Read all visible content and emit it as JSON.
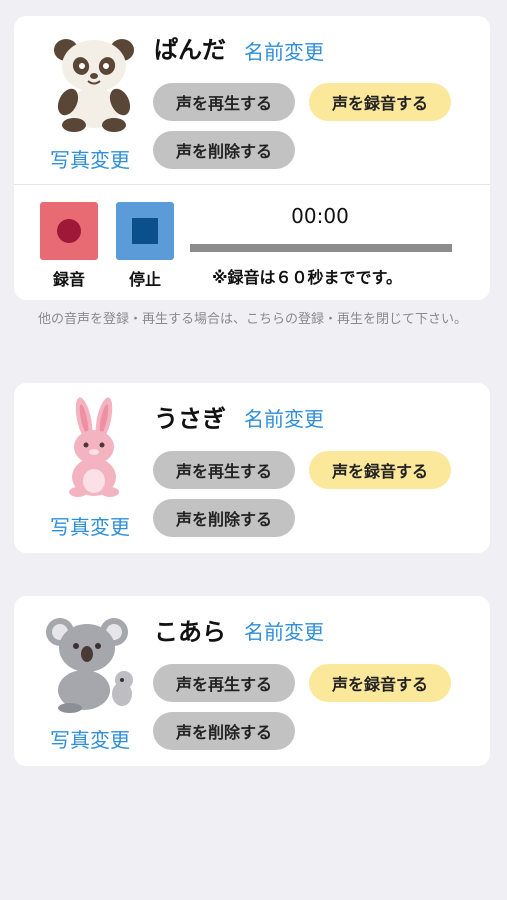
{
  "cards": [
    {
      "name": "ぱんだ",
      "rename_label": "名前変更",
      "photo_label": "写真変更",
      "play_label": "声を再生する",
      "record_label": "声を録音する",
      "delete_label": "声を削除する",
      "icon": "panda-icon"
    },
    {
      "name": "うさぎ",
      "rename_label": "名前変更",
      "photo_label": "写真変更",
      "play_label": "声を再生する",
      "record_label": "声を録音する",
      "delete_label": "声を削除する",
      "icon": "rabbit-icon"
    },
    {
      "name": "こあら",
      "rename_label": "名前変更",
      "photo_label": "写真変更",
      "play_label": "声を再生する",
      "record_label": "声を録音する",
      "delete_label": "声を削除する",
      "icon": "koala-icon"
    }
  ],
  "recorder": {
    "record_label": "録音",
    "stop_label": "停止",
    "timer": "00:00",
    "note": "※録音は６０秒までです。",
    "record_color": "#e86a72",
    "stop_color": "#5b9bd8"
  },
  "hint": "他の音声を登録・再生する場合は、こちらの登録・再生を閉じて下さい。",
  "colors": {
    "link": "#2f8fd8",
    "gray_button": "#c2c2c2",
    "yellow_button": "#fbe89a",
    "background": "#efeff4"
  }
}
